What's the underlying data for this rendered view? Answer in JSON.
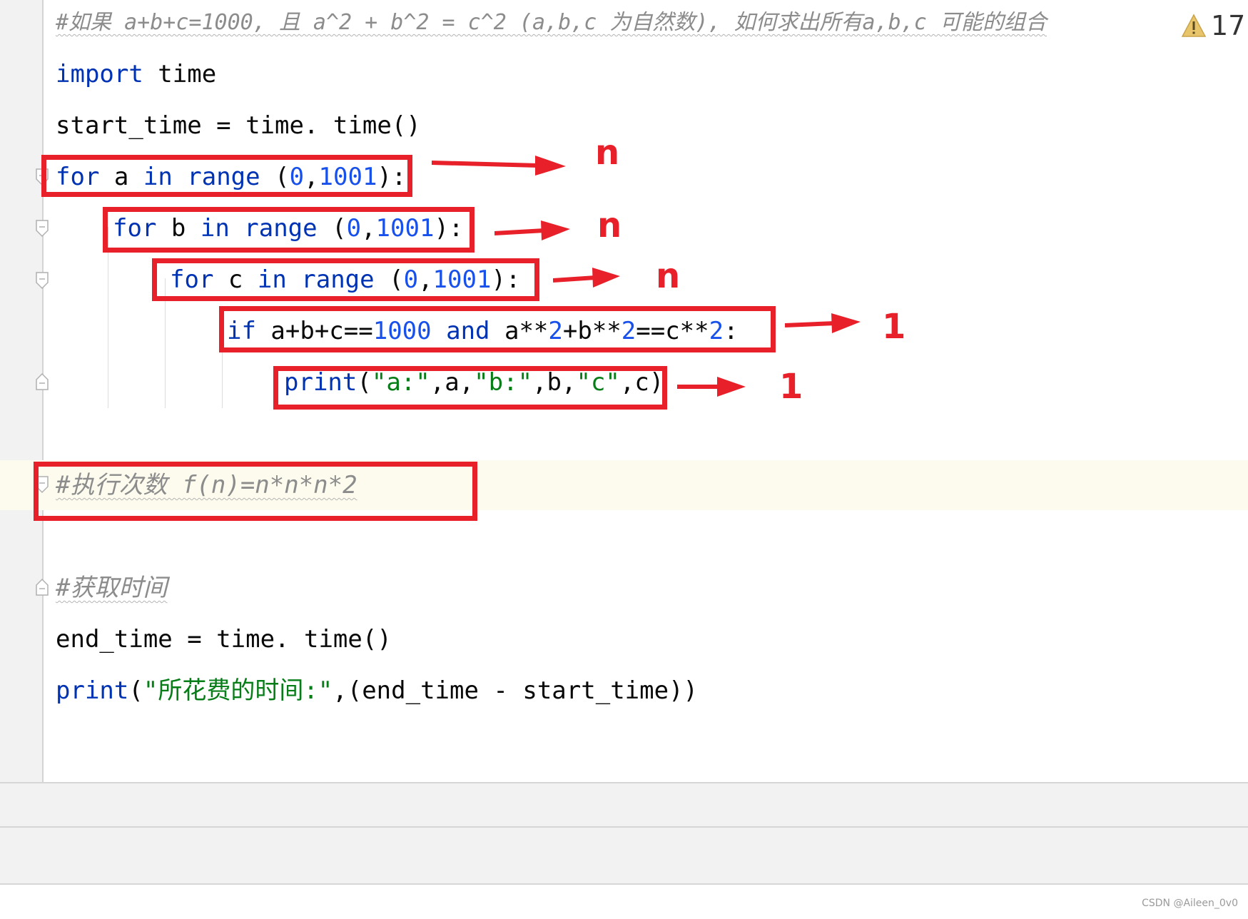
{
  "editor": {
    "warnings_count": "17",
    "lines": {
      "header_comment": "#如果 a+b+c=1000, 且 a^2 + b^2 = c^2 (a,b,c 为自然数), 如何求出所有a,b,c 可能的组合",
      "import_kw": "import",
      "import_mod": " time",
      "start_time": "start_time = time. time()",
      "for_a": {
        "kw1": "for",
        "var": " a ",
        "kw2": "in",
        "fn": " range",
        "p1": " (",
        "n0": "0",
        "comma": ",",
        "n1": "1001",
        "p2": "):"
      },
      "for_b": {
        "kw1": "for",
        "var": " b ",
        "kw2": "in",
        "fn": " range",
        "p1": " (",
        "n0": "0",
        "comma": ",",
        "n1": "1001",
        "p2": "):"
      },
      "for_c": {
        "kw1": "for",
        "var": " c ",
        "kw2": "in",
        "fn": " range",
        "p1": " (",
        "n0": "0",
        "comma": ",",
        "n1": "1001",
        "p2": "):"
      },
      "if_line": {
        "kw1": "if",
        "t1": " a+b+c==",
        "n1": "1000",
        "sp": " ",
        "kw2": "and",
        "t2": " a**",
        "n2": "2",
        "t3": "+b**",
        "n3": "2",
        "t4": "==c**",
        "n4": "2",
        "t5": ":"
      },
      "print_line": {
        "fn": "print",
        "p1": "(",
        "s1": "\"a:\"",
        "t1": ",a,",
        "s2": "\"b:\"",
        "t2": ",b,",
        "s3": "\"c\"",
        "t3": ",c)"
      },
      "exec_comment": "#执行次数 f(n)=n*n*n*2",
      "time_comment": "#获取时间",
      "end_time": "end_time = time. time()",
      "final_print": {
        "fn": "print",
        "p1": "(",
        "s1": "\"所花费的时间:\"",
        "t1": ",(end_time - start_time))"
      }
    }
  },
  "annotations": {
    "labels": [
      "n",
      "n",
      "n",
      "1",
      "1"
    ],
    "color": "#e8202a"
  },
  "watermark": "CSDN @Aileen_0v0"
}
